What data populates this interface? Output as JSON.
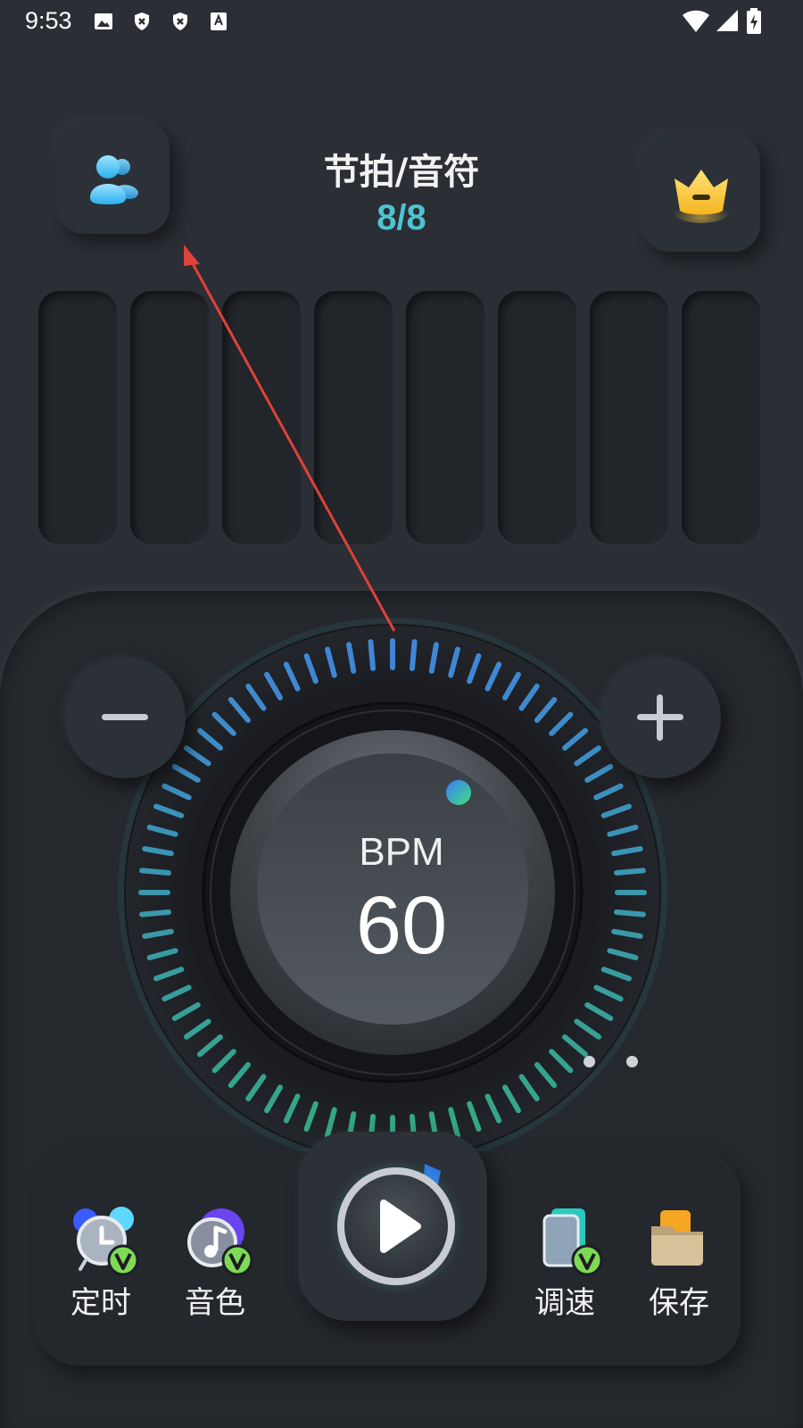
{
  "status_bar": {
    "time": "9:53",
    "icons": [
      "image-icon",
      "shield-x-icon",
      "shield-x-icon",
      "a-icon",
      "wifi-icon",
      "signal-icon",
      "battery-charging-icon"
    ]
  },
  "header": {
    "title": "节拍/音符",
    "beat_fraction": "8/8",
    "left_button_icon": "users-icon",
    "right_button_icon": "crown-icon"
  },
  "beat_bars": {
    "count": 8
  },
  "tempo": {
    "label": "BPM",
    "value": "60",
    "decrease_icon": "minus-icon",
    "increase_icon": "plus-icon",
    "page_indicator": {
      "count": 2
    }
  },
  "toolbar": {
    "items": [
      {
        "label": "定时",
        "icon": "timer-icon",
        "vip": "V"
      },
      {
        "label": "音色",
        "icon": "music-note-icon",
        "vip": "V"
      },
      {
        "label": "调速",
        "icon": "speed-adjust-icon",
        "vip": "V"
      },
      {
        "label": "保存",
        "icon": "folder-icon"
      }
    ],
    "play_icon": "play-icon"
  },
  "colors": {
    "background": "#2b2e34",
    "accent_teal": "#4fc3d0",
    "tick_blue": "#3f86d6",
    "tick_green": "#35a784",
    "annotation_arrow": "#e0413a",
    "vip_badge": "#7ed957"
  }
}
